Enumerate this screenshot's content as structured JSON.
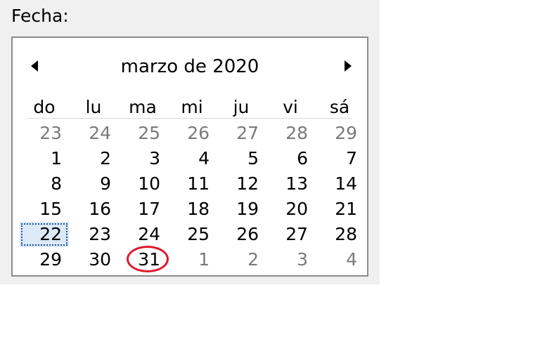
{
  "field_label": "Fecha:",
  "calendar": {
    "month_title": "marzo de 2020",
    "prev_icon": "triangle-left-icon",
    "next_icon": "triangle-right-icon",
    "weekdays": [
      "do",
      "lu",
      "ma",
      "mi",
      "ju",
      "vi",
      "sá"
    ],
    "weeks": [
      [
        {
          "d": "23",
          "other": true
        },
        {
          "d": "24",
          "other": true
        },
        {
          "d": "25",
          "other": true
        },
        {
          "d": "26",
          "other": true
        },
        {
          "d": "27",
          "other": true
        },
        {
          "d": "28",
          "other": true
        },
        {
          "d": "29",
          "other": true
        }
      ],
      [
        {
          "d": "1"
        },
        {
          "d": "2"
        },
        {
          "d": "3"
        },
        {
          "d": "4"
        },
        {
          "d": "5"
        },
        {
          "d": "6"
        },
        {
          "d": "7"
        }
      ],
      [
        {
          "d": "8"
        },
        {
          "d": "9"
        },
        {
          "d": "10"
        },
        {
          "d": "11"
        },
        {
          "d": "12"
        },
        {
          "d": "13"
        },
        {
          "d": "14"
        }
      ],
      [
        {
          "d": "15"
        },
        {
          "d": "16"
        },
        {
          "d": "17"
        },
        {
          "d": "18"
        },
        {
          "d": "19"
        },
        {
          "d": "20"
        },
        {
          "d": "21"
        }
      ],
      [
        {
          "d": "22",
          "today": true
        },
        {
          "d": "23"
        },
        {
          "d": "24"
        },
        {
          "d": "25"
        },
        {
          "d": "26"
        },
        {
          "d": "27"
        },
        {
          "d": "28"
        }
      ],
      [
        {
          "d": "29"
        },
        {
          "d": "30"
        },
        {
          "d": "31",
          "circled": true
        },
        {
          "d": "1",
          "other": true
        },
        {
          "d": "2",
          "other": true
        },
        {
          "d": "3",
          "other": true
        },
        {
          "d": "4",
          "other": true
        }
      ]
    ],
    "today_day": "22",
    "circled_day": "31",
    "colors": {
      "other_month_text": "#7a7a7a",
      "today_focus": "#1b4f9c",
      "annotation_circle": "#e0162b"
    }
  }
}
